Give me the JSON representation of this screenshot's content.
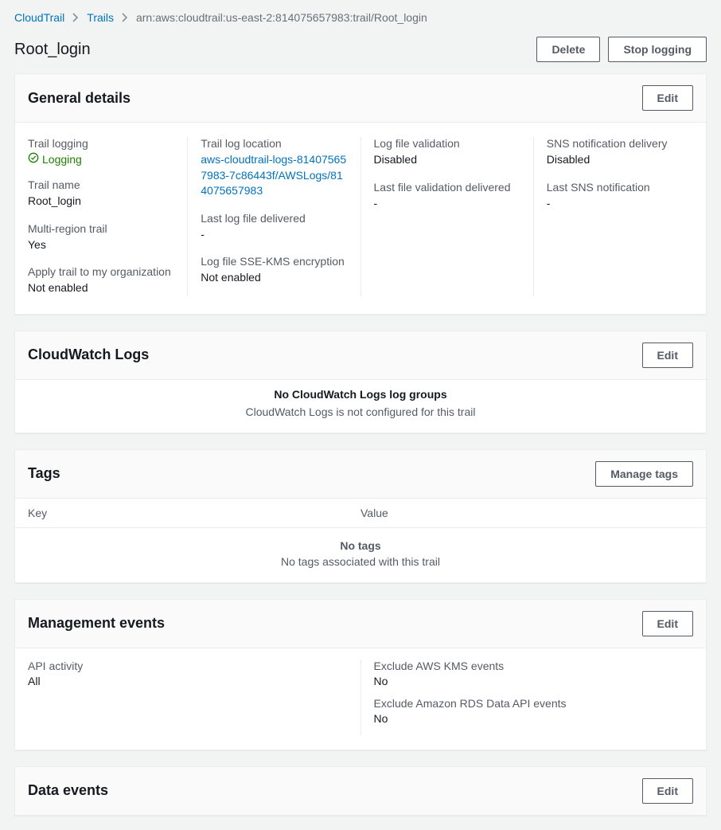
{
  "breadcrumb": {
    "root": "CloudTrail",
    "trails": "Trails",
    "arn": "arn:aws:cloudtrail:us-east-2:814075657983:trail/Root_login"
  },
  "page_title": "Root_login",
  "actions": {
    "delete": "Delete",
    "stop_logging": "Stop logging"
  },
  "general": {
    "title": "General details",
    "edit": "Edit",
    "trail_logging_label": "Trail logging",
    "trail_logging_status": "Logging",
    "trail_name_label": "Trail name",
    "trail_name_value": "Root_login",
    "multi_region_label": "Multi-region trail",
    "multi_region_value": "Yes",
    "apply_org_label": "Apply trail to my organization",
    "apply_org_value": "Not enabled",
    "log_location_label": "Trail log location",
    "log_location_value": "aws-cloudtrail-logs-814075657983-7c86443f/AWSLogs/814075657983",
    "last_log_delivered_label": "Last log file delivered",
    "last_log_delivered_value": "-",
    "sse_kms_label": "Log file SSE-KMS encryption",
    "sse_kms_value": "Not enabled",
    "validation_label": "Log file validation",
    "validation_value": "Disabled",
    "last_validation_label": "Last file validation delivered",
    "last_validation_value": "-",
    "sns_delivery_label": "SNS notification delivery",
    "sns_delivery_value": "Disabled",
    "last_sns_label": "Last SNS notification",
    "last_sns_value": "-"
  },
  "cloudwatch": {
    "title": "CloudWatch Logs",
    "edit": "Edit",
    "empty_title": "No CloudWatch Logs log groups",
    "empty_sub": "CloudWatch Logs is not configured for this trail"
  },
  "tags": {
    "title": "Tags",
    "manage": "Manage tags",
    "col_key": "Key",
    "col_value": "Value",
    "empty_title": "No tags",
    "empty_sub": "No tags associated with this trail"
  },
  "management": {
    "title": "Management events",
    "edit": "Edit",
    "api_activity_label": "API activity",
    "api_activity_value": "All",
    "exclude_kms_label": "Exclude AWS KMS events",
    "exclude_kms_value": "No",
    "exclude_rds_label": "Exclude Amazon RDS Data API events",
    "exclude_rds_value": "No"
  },
  "data_events": {
    "title": "Data events",
    "edit": "Edit"
  }
}
